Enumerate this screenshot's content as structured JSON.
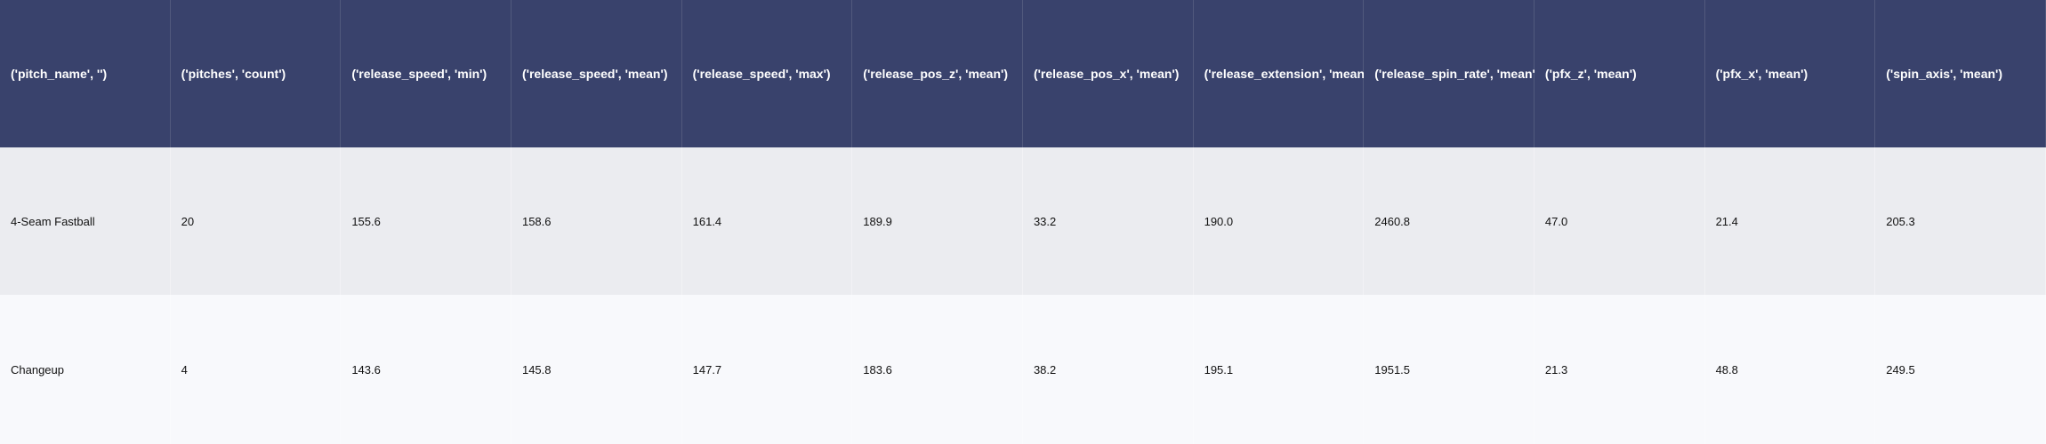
{
  "chart_data": {
    "type": "table",
    "columns": [
      "('pitch_name', '')",
      "('pitches', 'count')",
      "('release_speed', 'min')",
      "('release_speed', 'mean')",
      "('release_speed', 'max')",
      "('release_pos_z', 'mean')",
      "('release_pos_x', 'mean')",
      "('release_extension', 'mean')",
      "('release_spin_rate', 'mean')",
      "('pfx_z', 'mean')",
      "('pfx_x', 'mean')",
      "('spin_axis', 'mean')"
    ],
    "rows": [
      [
        "4-Seam Fastball",
        "20",
        "155.6",
        "158.6",
        "161.4",
        "189.9",
        "33.2",
        "190.0",
        "2460.8",
        "47.0",
        "21.4",
        "205.3"
      ],
      [
        "Changeup",
        "4",
        "143.6",
        "145.8",
        "147.7",
        "183.6",
        "38.2",
        "195.1",
        "1951.5",
        "21.3",
        "48.8",
        "249.5"
      ]
    ]
  },
  "colors": {
    "header_bg": "#39426c",
    "header_text": "#ffffff",
    "row_odd_bg": "#ebecf0",
    "row_even_bg": "#f8f9fc",
    "cell_text": "#111111"
  }
}
